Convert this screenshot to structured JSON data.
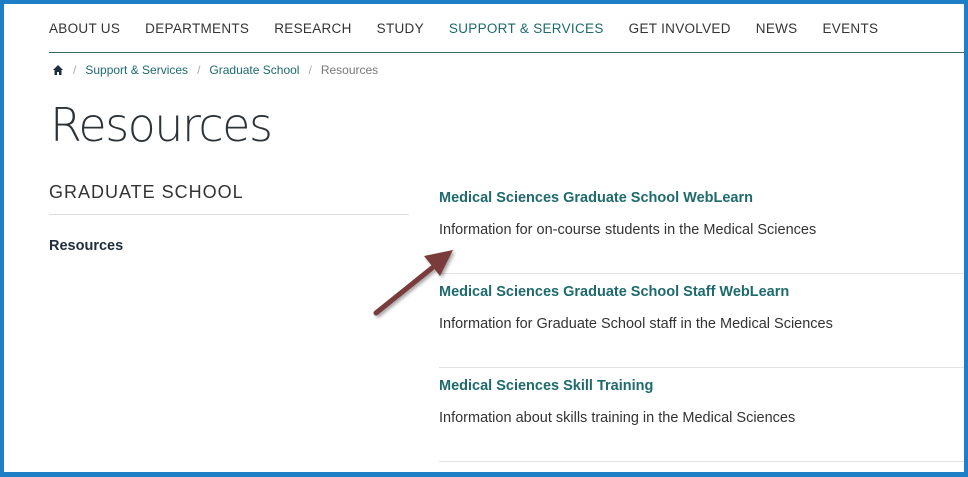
{
  "nav": {
    "items": [
      {
        "label": "ABOUT US"
      },
      {
        "label": "DEPARTMENTS"
      },
      {
        "label": "RESEARCH"
      },
      {
        "label": "STUDY"
      },
      {
        "label": "SUPPORT & SERVICES",
        "active": true
      },
      {
        "label": "GET INVOLVED"
      },
      {
        "label": "NEWS"
      },
      {
        "label": "EVENTS"
      }
    ]
  },
  "breadcrumb": {
    "home_icon": "home-icon",
    "items": [
      {
        "label": "Support & Services"
      },
      {
        "label": "Graduate School"
      },
      {
        "label": "Resources"
      }
    ]
  },
  "page": {
    "title": "Resources"
  },
  "sidebar": {
    "heading": "GRADUATE SCHOOL",
    "links": [
      {
        "label": "Resources"
      }
    ]
  },
  "results": [
    {
      "title": "Medical Sciences Graduate School WebLearn",
      "description": "Information for on-course students in the Medical Sciences"
    },
    {
      "title": "Medical Sciences Graduate School Staff WebLearn",
      "description": "Information for Graduate School staff in the Medical Sciences"
    },
    {
      "title": "Medical Sciences Skill Training",
      "description": "Information about skills training in the Medical Sciences"
    }
  ],
  "colors": {
    "frame": "#1f7fc6",
    "accent": "#1e6a6d",
    "annotation_arrow": "#7a3b3b"
  }
}
